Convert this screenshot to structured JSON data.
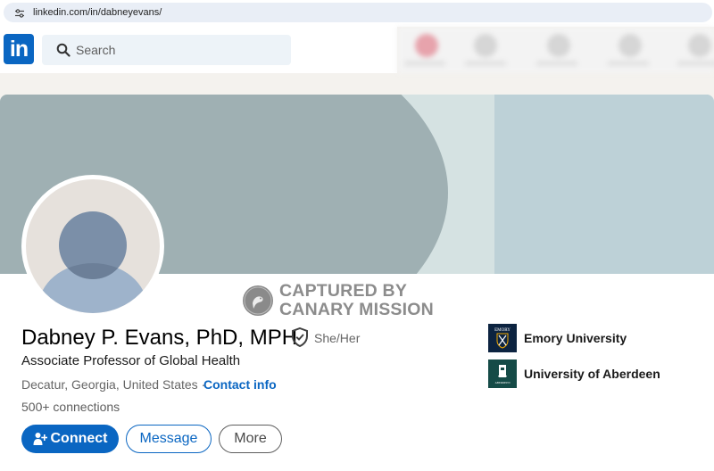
{
  "browser": {
    "url": "linkedin.com/in/dabneyevans/"
  },
  "nav": {
    "logo_text": "in",
    "search_placeholder": "Search"
  },
  "watermark": {
    "line1": "CAPTURED BY",
    "line2": "CANARY MISSION"
  },
  "profile": {
    "name": "Dabney P. Evans, PhD, MPH",
    "pronouns": "She/Her",
    "headline": "Associate Professor of Global Health",
    "location": "Decatur, Georgia, United States · ",
    "contact_link": "Contact info",
    "connections": "500+ connections"
  },
  "actions": {
    "connect": "Connect",
    "message": "Message",
    "more": "More"
  },
  "organizations": [
    {
      "name": "Emory University",
      "logo_text": "EMORY",
      "color": "#0c2340"
    },
    {
      "name": "University of Aberdeen",
      "logo_text": "ABERDEEN",
      "color": "#154b47"
    }
  ],
  "colors": {
    "brand": "#0a66c2",
    "cover": "#9fb0b3",
    "cover_right": "#bdd1d7"
  }
}
